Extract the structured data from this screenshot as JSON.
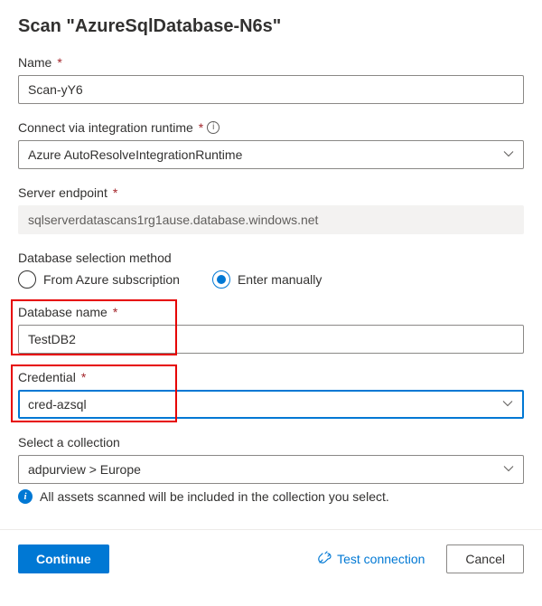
{
  "header": {
    "title": "Scan \"AzureSqlDatabase-N6s\""
  },
  "name": {
    "label": "Name",
    "value": "Scan-yY6"
  },
  "runtime": {
    "label": "Connect via integration runtime",
    "value": "Azure AutoResolveIntegrationRuntime"
  },
  "endpoint": {
    "label": "Server endpoint",
    "value": "sqlserverdatascans1rg1ause.database.windows.net"
  },
  "dbmethod": {
    "label": "Database selection method",
    "opt_subscription": "From Azure subscription",
    "opt_manual": "Enter manually",
    "selected": "manual"
  },
  "dbname": {
    "label": "Database name",
    "value": "TestDB2"
  },
  "credential": {
    "label": "Credential",
    "value": "cred-azsql"
  },
  "collection": {
    "label": "Select a collection",
    "value": "adpurview > Europe",
    "hint": "All assets scanned will be included in the collection you select."
  },
  "footer": {
    "continue": "Continue",
    "test": "Test connection",
    "cancel": "Cancel"
  }
}
